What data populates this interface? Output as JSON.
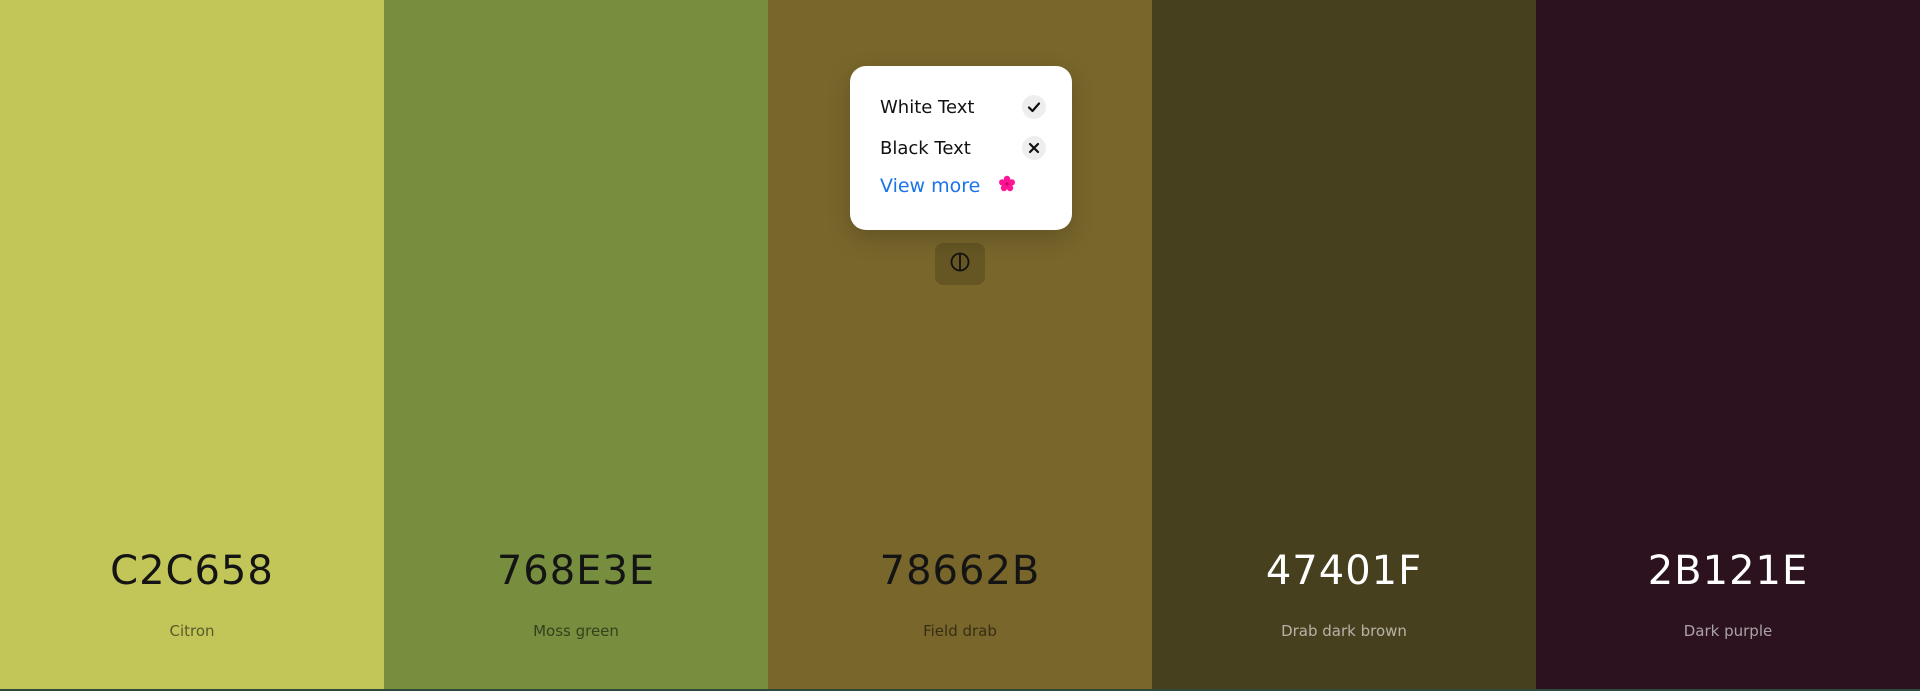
{
  "swatches": [
    {
      "hex": "C2C658",
      "name": "Citron",
      "color": "#C2C658",
      "text": "dark"
    },
    {
      "hex": "768E3E",
      "name": "Moss green",
      "color": "#768E3E",
      "text": "dark"
    },
    {
      "hex": "78662B",
      "name": "Field drab",
      "color": "#78662B",
      "text": "dark"
    },
    {
      "hex": "47401F",
      "name": "Drab dark brown",
      "color": "#47401F",
      "text": "light"
    },
    {
      "hex": "2B121E",
      "name": "Dark purple",
      "color": "#2B121E",
      "text": "light"
    }
  ],
  "popover": {
    "white_text_label": "White Text",
    "white_text_icon": "check-icon",
    "black_text_label": "Black Text",
    "black_text_icon": "close-icon",
    "view_more_label": "View more",
    "view_more_icon": "flower-icon",
    "view_more_color": "#1a73e8",
    "flower_color": "#ff1493"
  },
  "contrast_button": {
    "icon": "contrast-icon"
  }
}
